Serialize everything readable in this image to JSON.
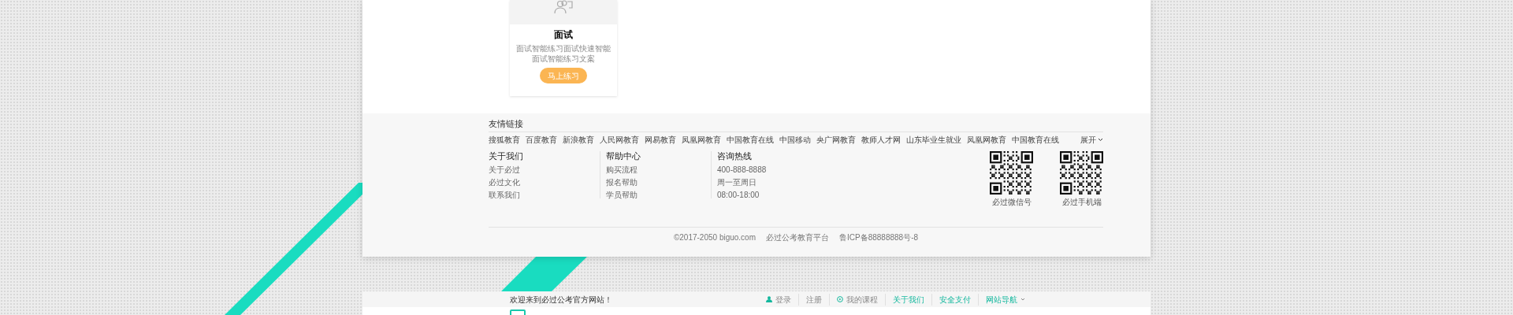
{
  "card": {
    "title": "面试",
    "description": "面试智能练习面试快速智能面试智能练习文案",
    "button": "马上练习"
  },
  "friend_links": {
    "title": "友情链接",
    "links": [
      "搜狐教育",
      "百度教育",
      "新浪教育",
      "人民网教育",
      "网易教育",
      "凤凰网教育",
      "中国教育在线",
      "中国移动",
      "央广网教育",
      "教师人才网",
      "山东毕业生就业",
      "凤凰网教育",
      "中国教育在线"
    ],
    "expand": "展开"
  },
  "footer_columns": [
    {
      "title": "关于我们",
      "items": [
        "关于必过",
        "必过文化",
        "联系我们"
      ]
    },
    {
      "title": "帮助中心",
      "items": [
        "购买流程",
        "报名帮助",
        "学员帮助"
      ]
    },
    {
      "title": "咨询热线",
      "items": [
        "400-888-8888",
        "周一至周日",
        "08:00-18:00"
      ]
    }
  ],
  "qr_codes": [
    {
      "caption": "必过微信号"
    },
    {
      "caption": "必过手机端"
    }
  ],
  "copyright": [
    "©2017-2050 biguo.com",
    "必过公考教育平台",
    "鲁ICP备88888888号-8"
  ],
  "top_bar": {
    "welcome": "欢迎来到必过公考官方网站！",
    "items": [
      {
        "label": "登录",
        "kind": "user"
      },
      {
        "label": "注册",
        "kind": "plain"
      },
      {
        "label": "我的课程",
        "kind": "play"
      },
      {
        "label": "关于我们",
        "kind": "accent"
      },
      {
        "label": "安全支付",
        "kind": "accent"
      },
      {
        "label": "网站导航",
        "kind": "menu"
      }
    ]
  }
}
